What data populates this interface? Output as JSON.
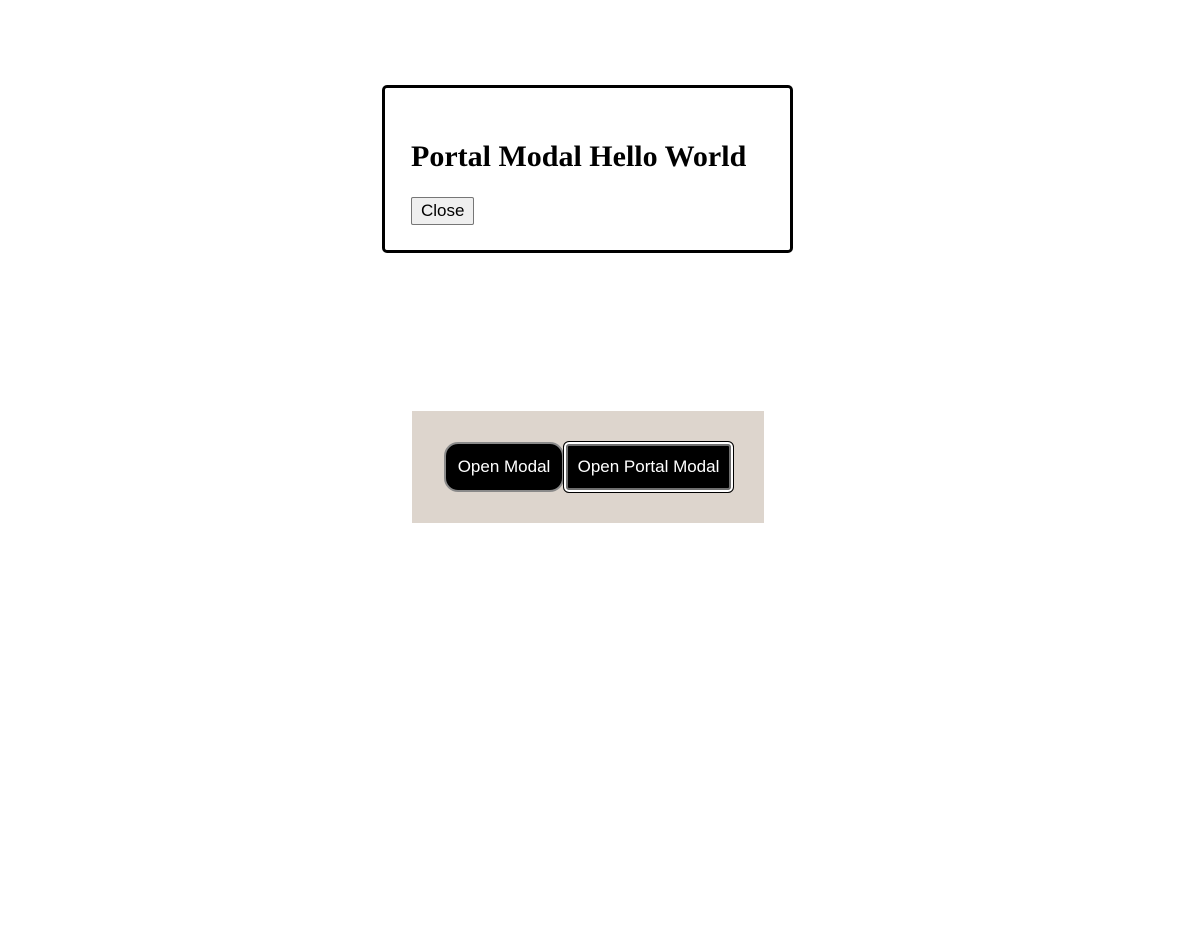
{
  "modal": {
    "title": "Portal Modal Hello World",
    "close_label": "Close"
  },
  "panel": {
    "open_modal_label": "Open Modal",
    "open_portal_modal_label": "Open Portal Modal",
    "background_color": "#ddd5cd"
  }
}
